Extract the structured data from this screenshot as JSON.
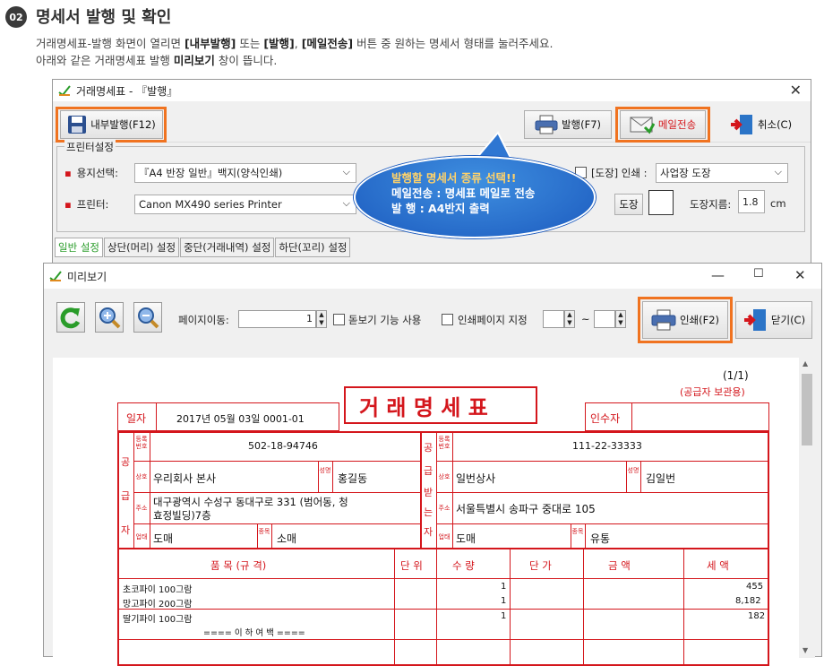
{
  "step": {
    "number": "02",
    "title": "명세서 발행 및 확인"
  },
  "intro": {
    "l1_a": "거래명세표-발행 화면이 열리면 ",
    "l1_b": "[내부발행]",
    "l1_c": " 또는 ",
    "l1_d": "[발행]",
    "l1_e": ", ",
    "l1_f": "[메일전송]",
    "l1_g": " 버튼 중 원하는 명세서 형태를 눌러주세요.",
    "l2_a": "아래와 같은 거래명세표 발행 ",
    "l2_b": "미리보기",
    "l2_c": " 창이 뜹니다."
  },
  "main_window": {
    "title": "거래명세표 - 『발행』",
    "close": "✕",
    "btn_internal": "내부발행(F12)",
    "btn_issue": "발행(F7)",
    "btn_email": "메일전송",
    "btn_cancel": "취소(C)",
    "printer_settings": "프린터설정",
    "paper_label": "용지선택:",
    "paper_value": "『A4 반장 일반』백지(양식인쇄)",
    "printer_label": "프린터:",
    "printer_value": "Canon MX490 series Printer",
    "stamp_label": "[도장] 인쇄 :",
    "stamp_value": "사업장 도장",
    "stamp_btn": "도장",
    "stamp_size_label": "도장지름:",
    "stamp_size": "1.8",
    "stamp_unit": "cm",
    "tabs": [
      "일반 설정",
      "상단(머리) 설정",
      "중단(거래내역) 설정",
      "하단(꼬리) 설정"
    ]
  },
  "callout": {
    "line1": "발행할 명세서 종류 선택!!",
    "line2": "메일전송 : 명세표 메일로 전송",
    "line3": "발      행 : A4반지 출력"
  },
  "preview": {
    "title": "미리보기",
    "page_move": "페이지이동:",
    "page_value": "1",
    "zoom_label": "돋보기 기능 사용",
    "print_page_label": "인쇄페이지 지정",
    "tilde": "~",
    "btn_print": "인쇄(F2)",
    "btn_close": "닫기(C)"
  },
  "invoice": {
    "page": "(1/1)",
    "copy": "(공급자 보관용)",
    "title": "거 래 명 세 표",
    "date_label": "일자",
    "date": "2017년 05월 03일   0001-01",
    "recipient_label": "인수자",
    "supplier_side": [
      "공",
      "급",
      "자"
    ],
    "buyer_side": [
      "공",
      "급",
      "받",
      "는",
      "자"
    ],
    "reg_label": "등록번호",
    "name_label": "상호",
    "rep_label": "성명",
    "addr_label": "주소",
    "biz_label": "업태",
    "type_label": "종목",
    "supplier": {
      "reg": "502-18-94746",
      "name": "우리회사 본사",
      "rep": "홍길동",
      "addr1": "대구광역시 수성구 동대구로 331 (범어동, 청",
      "addr2": "효정빌딩)7층",
      "biz": "도매",
      "type": "소매"
    },
    "buyer": {
      "reg": "111-22-33333",
      "name": "일번상사",
      "rep": "김일번",
      "addr": "서울특별시 송파구 중대로 105",
      "biz": "도매",
      "type": "유통"
    },
    "headers": [
      "품   목 (규   격)",
      "단 위",
      "수  량",
      "단   가",
      "금     액",
      "세   액"
    ],
    "items": [
      {
        "name": "초코파이 100그람",
        "qty": "1",
        "tax": "455"
      },
      {
        "name": "망고파이 200그람",
        "qty": "1",
        "tax": "8,182"
      },
      {
        "name": "딸기파이 100그람",
        "qty": "1",
        "tax": "182"
      }
    ],
    "end_mark": "==== 이 하 여 백 ===="
  }
}
